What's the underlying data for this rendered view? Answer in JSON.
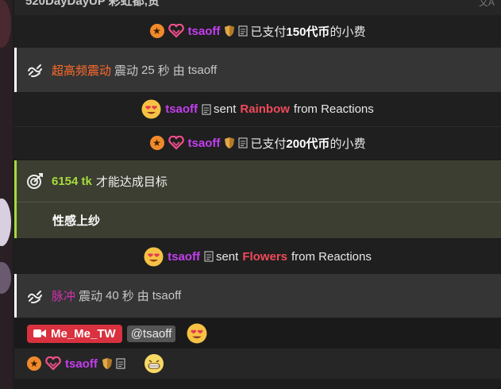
{
  "header": {
    "partial_text": "520DayDayUP 彩虹都,贵",
    "translate_icon": "translate-icon"
  },
  "tips": [
    {
      "user": "tsaoff",
      "pre": "已支付",
      "amount": "150代币",
      "post": "的小费"
    },
    {
      "user": "tsaoff",
      "pre": "已支付",
      "amount": "200代币",
      "post": "的小费"
    }
  ],
  "vibes": [
    {
      "level": "超高频震动",
      "middle": "震动",
      "seconds": "25",
      "unit": "秒",
      "by": "由",
      "user": "tsaoff"
    },
    {
      "level": "脉冲",
      "middle": "震动",
      "seconds": "40",
      "unit": "秒",
      "by": "由",
      "user": "tsaoff"
    }
  ],
  "reactions": [
    {
      "user": "tsaoff",
      "sent": "sent",
      "item": "Rainbow",
      "from": "from Reactions"
    },
    {
      "user": "tsaoff",
      "sent": "sent",
      "item": "Flowers",
      "from": "from Reactions"
    }
  ],
  "goal": {
    "amount": "6154 tk",
    "text": "才能达成目标",
    "description": "性感上纱"
  },
  "message": {
    "author": "Me_Me_TW",
    "mention": "@tsaoff"
  },
  "bottom": {
    "user": "tsaoff"
  },
  "colors": {
    "username": "#c43ef0",
    "goal_accent": "#a6db3c",
    "reaction_item": "#ef4a5a",
    "vibe_orange": "#ff6a2a",
    "vibe_magenta": "#d32fb0",
    "tag_red": "#d9313f"
  }
}
